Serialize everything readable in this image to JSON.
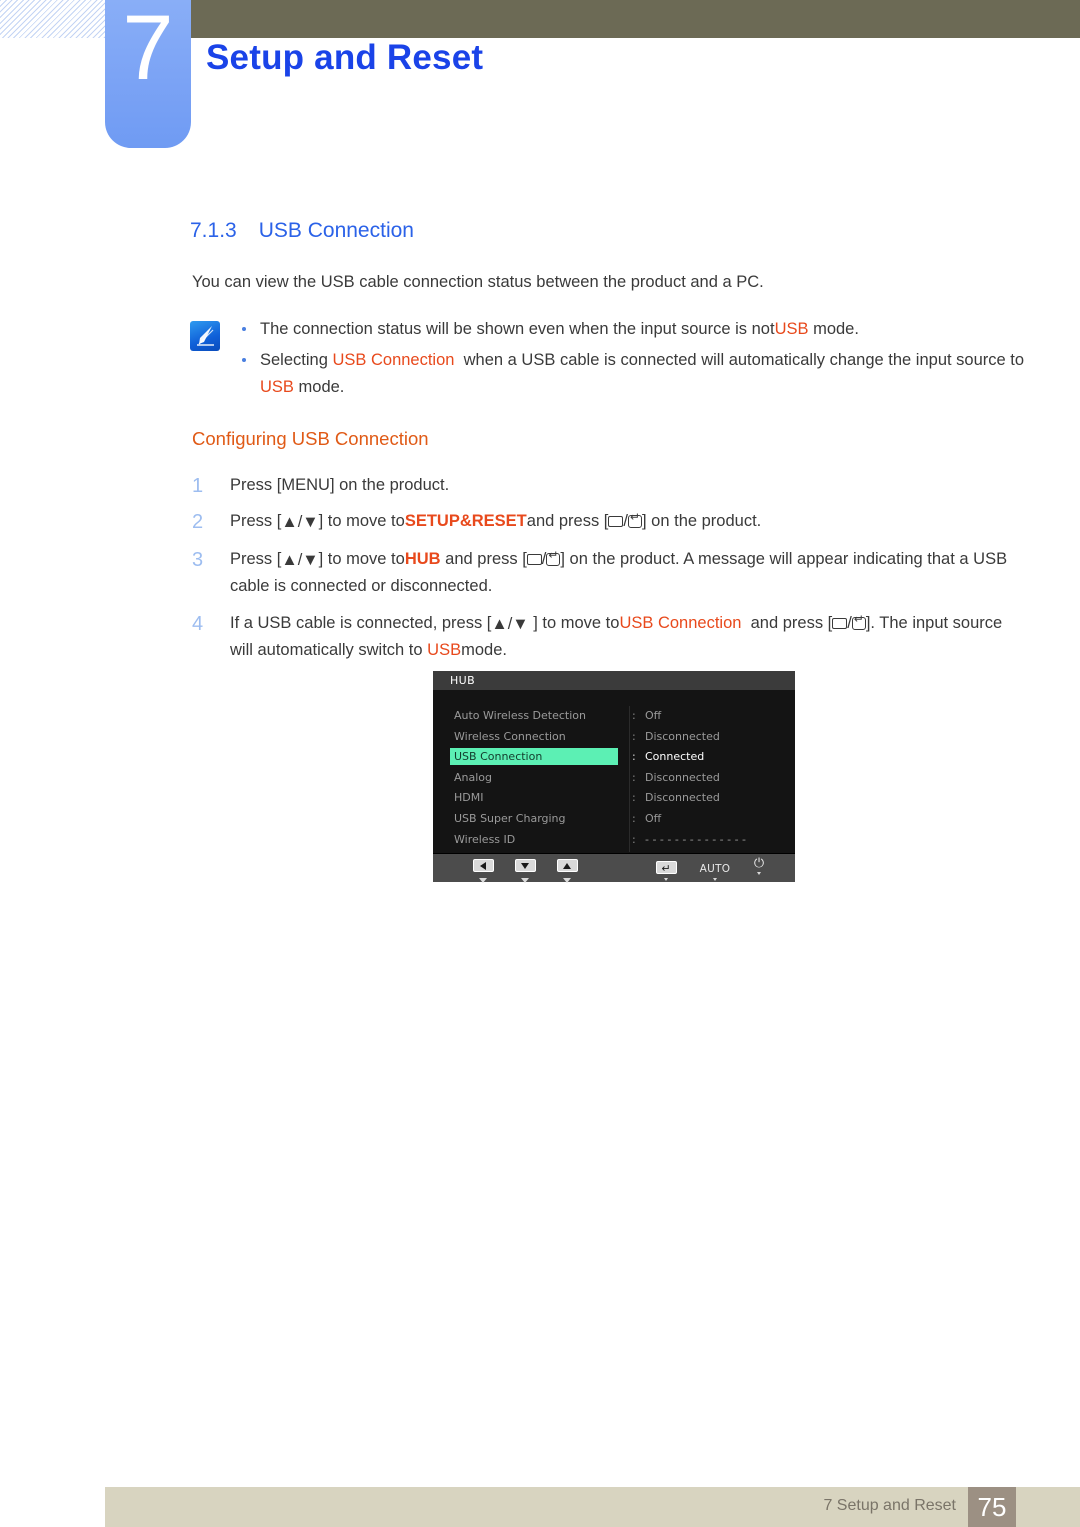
{
  "header": {
    "chapter_number": "7",
    "chapter_title": "Setup and Reset"
  },
  "section": {
    "number": "7.1.3",
    "title": "USB Connection",
    "intro": "You can view the USB cable connection status between the product and a PC."
  },
  "note": {
    "icon": "note-pen-icon",
    "items": [
      {
        "parts": [
          {
            "t": "The connection status will be shown even when the input source is not ",
            "style": "plain"
          },
          {
            "t": "USB",
            "style": "red"
          },
          {
            "t": " mode.",
            "style": "plain"
          }
        ]
      },
      {
        "parts": [
          {
            "t": "Selecting ",
            "style": "plain"
          },
          {
            "t": "USB Connection",
            "style": "red"
          },
          {
            "t": "  when a USB cable is connected will automatically change the input source to ",
            "style": "plain"
          },
          {
            "t": "USB",
            "style": "red"
          },
          {
            "t": " mode.",
            "style": "plain"
          }
        ]
      }
    ]
  },
  "procedure": {
    "heading": "Configuring USB Connection",
    "steps": [
      {
        "n": "1",
        "text": "Press [MENU] on the product."
      },
      {
        "n": "2",
        "text": "Press [▲/▼] to move to SETUP&RESET and press [SOURCE/ENTER] on the product."
      },
      {
        "n": "3",
        "text": "Press [▲/▼] to move to HUB and press [SOURCE/ENTER] on the product. A message will appear indicating that a USB cable is connected or disconnected."
      },
      {
        "n": "4",
        "text": "If a USB cable is connected, press [▲/▼] to move to USB Connection and press [SOURCE/ENTER]. The input source will automatically switch to USB mode."
      }
    ],
    "labels": {
      "menu_key": "MENU",
      "setup_reset": "SETUP&RESET",
      "hub": "HUB",
      "usb_connection": "USB Connection",
      "usb": "USB"
    }
  },
  "osd": {
    "title": "HUB",
    "rows": [
      {
        "label": "Auto Wireless Detection",
        "value": "Off",
        "selected": false
      },
      {
        "label": "Wireless Connection",
        "value": "Disconnected",
        "selected": false
      },
      {
        "label": "USB Connection",
        "value": "Connected",
        "selected": true
      },
      {
        "label": "Analog",
        "value": "Disconnected",
        "selected": false
      },
      {
        "label": "HDMI",
        "value": "Disconnected",
        "selected": false
      },
      {
        "label": "USB Super Charging",
        "value": "Off",
        "selected": false
      },
      {
        "label": "Wireless ID",
        "value": "- - - - - - - - - - - - - -",
        "selected": false
      }
    ],
    "colon": ":",
    "highlight_color": "#5cf0b4",
    "buttons": [
      {
        "name": "left-arrow-button",
        "label": ""
      },
      {
        "name": "down-arrow-button",
        "label": ""
      },
      {
        "name": "up-arrow-button",
        "label": ""
      },
      {
        "name": "enter-button",
        "label": "↵"
      },
      {
        "name": "auto-button",
        "label": "AUTO"
      },
      {
        "name": "power-button",
        "label": "⏻"
      }
    ]
  },
  "footer": {
    "text": "7 Setup and Reset",
    "page": "75"
  }
}
